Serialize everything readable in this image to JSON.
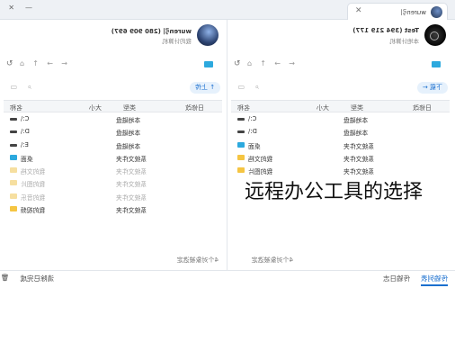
{
  "titlebar": {
    "tab_label": "wuren引",
    "close_icon": "✕",
    "minimize_glyph": "—",
    "close_glyph": "✕"
  },
  "left_pane": {
    "user": {
      "name": "wuren引 (280 909 697)",
      "subtitle": "我的计算机"
    },
    "toolbar": {
      "upload_label": "↑ 上传"
    },
    "columns": {
      "name": "名称",
      "size": "大小",
      "type": "类型",
      "modified": "日修改"
    },
    "rows": [
      {
        "name": "C:\\",
        "type": "本地磁盘",
        "icon": "drive",
        "dim": false
      },
      {
        "name": "D:\\",
        "type": "本地磁盘",
        "icon": "drive",
        "dim": false
      },
      {
        "name": "E:\\",
        "type": "本地磁盘",
        "icon": "drive",
        "dim": false
      },
      {
        "name": "桌面",
        "type": "系统文件夹",
        "icon": "desktop",
        "dim": false
      },
      {
        "name": "我的文档",
        "type": "系统文件夹",
        "icon": "folder",
        "dim": true
      },
      {
        "name": "我的图片",
        "type": "系统文件夹",
        "icon": "folder",
        "dim": true
      },
      {
        "name": "我的音乐",
        "type": "系统文件夹",
        "icon": "folder",
        "dim": true
      },
      {
        "name": "我的视频",
        "type": "系统文件夹",
        "icon": "folder",
        "dim": false
      }
    ],
    "status": "4个对象被选定"
  },
  "right_pane": {
    "user": {
      "name": "Test (394 219 177)",
      "subtitle": "本地计算机"
    },
    "toolbar": {
      "download_label": "下载 ←"
    },
    "columns": {
      "name": "名称",
      "size": "大小",
      "type": "类型",
      "modified": "日修改"
    },
    "rows": [
      {
        "name": "C:\\",
        "type": "本地磁盘",
        "icon": "drive",
        "dim": false
      },
      {
        "name": "D:\\",
        "type": "本地磁盘",
        "icon": "drive",
        "dim": false
      },
      {
        "name": "桌面",
        "type": "系统文件夹",
        "icon": "desktop",
        "dim": false
      },
      {
        "name": "我的文档",
        "type": "系统文件夹",
        "icon": "folder",
        "dim": false
      },
      {
        "name": "我的图片",
        "type": "系统文件夹",
        "icon": "folder",
        "dim": false
      }
    ],
    "status": "4个对象被选定"
  },
  "bottom": {
    "tab_transfer": "传输列表",
    "tab_log": "传输日志",
    "clear_label": "清除已完成"
  },
  "overlay": {
    "caption": "远程办公工具的选择"
  },
  "colors": {
    "accent": "#1a6fcf",
    "folder": "#f5c542",
    "desktop": "#2ca9de"
  }
}
